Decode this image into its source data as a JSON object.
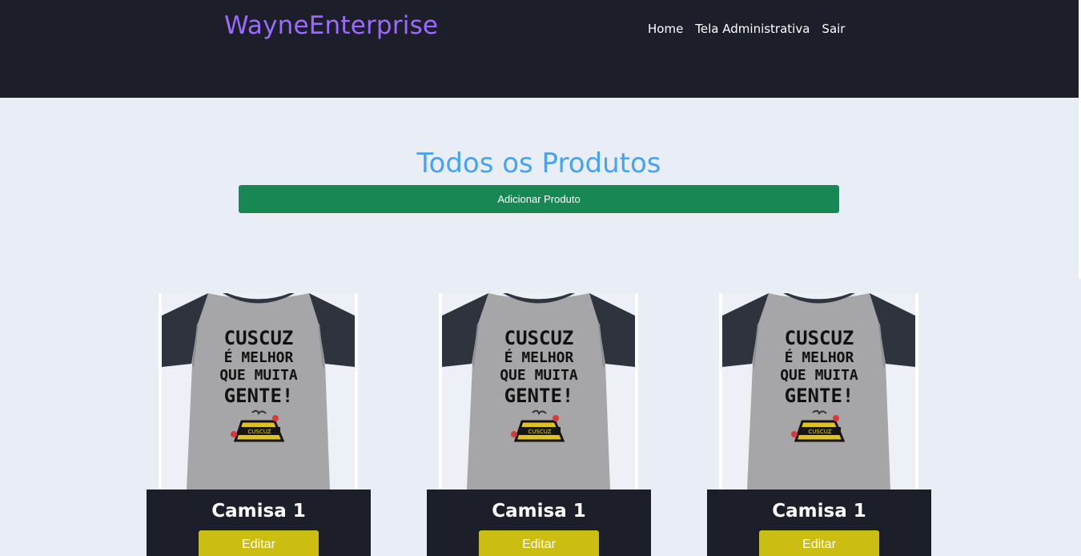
{
  "header": {
    "brand": "WayneEnterprise",
    "nav": [
      {
        "label": "Home"
      },
      {
        "label": "Tela Administrativa"
      },
      {
        "label": "Sair"
      }
    ]
  },
  "main": {
    "title": "Todos os Produtos",
    "add_button_label": "Adicionar Produto",
    "products": [
      {
        "name": "Camisa 1",
        "edit_label": "Editar",
        "shirt_text": [
          "CUSCUZ",
          "É MELHOR",
          "QUE MUITA",
          "GENTE!"
        ],
        "badge_text": "CUSCUZ"
      },
      {
        "name": "Camisa 1",
        "edit_label": "Editar",
        "shirt_text": [
          "CUSCUZ",
          "É MELHOR",
          "QUE MUITA",
          "GENTE!"
        ],
        "badge_text": "CUSCUZ"
      },
      {
        "name": "Camisa 1",
        "edit_label": "Editar",
        "shirt_text": [
          "CUSCUZ",
          "É MELHOR",
          "QUE MUITA",
          "GENTE!"
        ],
        "badge_text": "CUSCUZ"
      }
    ]
  },
  "colors": {
    "header_bg": "#1c1f29",
    "brand": "#9b6bff",
    "title": "#45a3f2",
    "add_button": "#198754",
    "edit_button": "#cbbd12",
    "page_bg": "#e9eef6"
  }
}
